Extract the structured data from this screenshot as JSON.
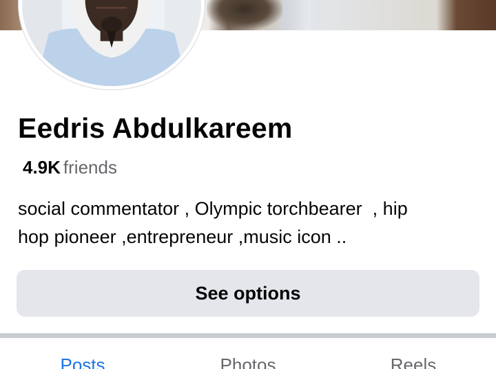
{
  "profile": {
    "name": "Eedris Abdulkareem",
    "friends_count": "4.9K",
    "friends_label": "friends",
    "bio_lines": [
      "social commentator , Olympic torchbearer  , hip",
      "hop pioneer ,entrepreneur ,music icon .."
    ]
  },
  "actions": {
    "see_options_label": "See options"
  },
  "tabs": [
    {
      "label": "Posts",
      "active": true
    },
    {
      "label": "Photos",
      "active": false
    },
    {
      "label": "Reels",
      "active": false
    }
  ],
  "colors": {
    "accent": "#1b74e4",
    "button_bg": "#e4e6eb",
    "secondary_text": "#65676b",
    "divider": "#c9ccd1"
  }
}
